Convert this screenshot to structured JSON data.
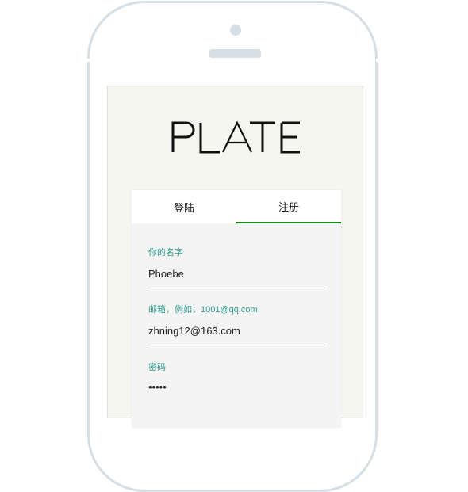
{
  "logo": {
    "text": "PLATE"
  },
  "tabs": [
    {
      "label": "登陆",
      "active": false
    },
    {
      "label": "注册",
      "active": true
    }
  ],
  "form": {
    "name": {
      "label": "你的名字",
      "value": "Phoebe"
    },
    "email": {
      "label": "邮箱，例如：1001@qq.com",
      "value": "zhning12@163.com"
    },
    "password": {
      "label": "密码",
      "value": "•••••"
    }
  },
  "colors": {
    "accent": "#1a8a1a",
    "label": "#2ea08c",
    "frame": "#d6dfe5",
    "screen": "#f4f6ef"
  }
}
